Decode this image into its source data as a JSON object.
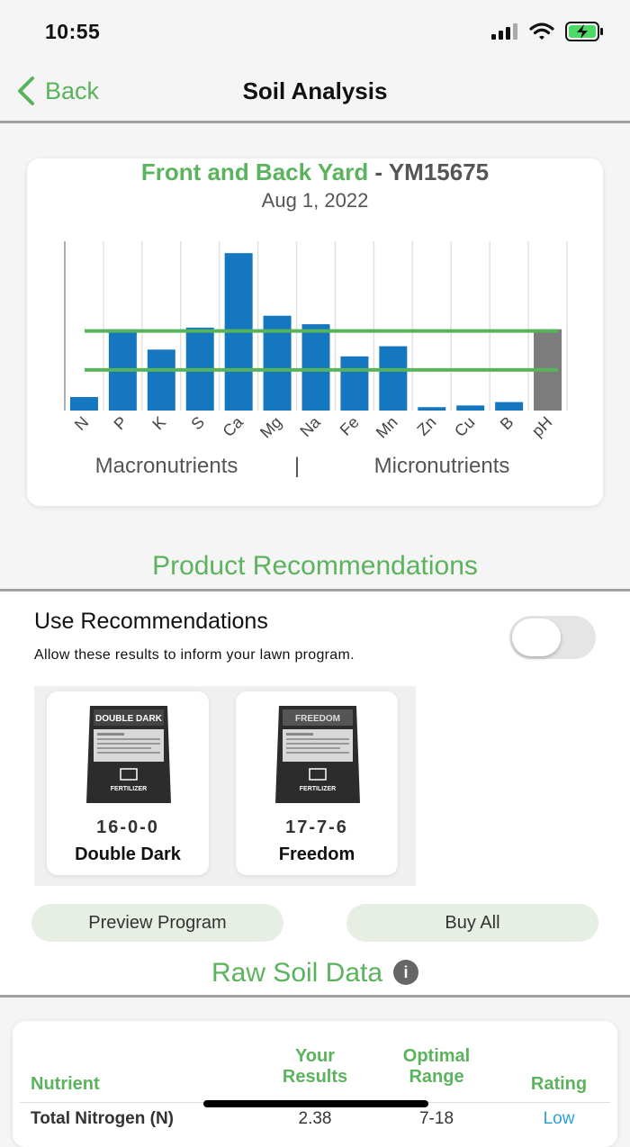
{
  "status_bar": {
    "time": "10:55"
  },
  "nav": {
    "back_label": "Back",
    "title": "Soil Analysis"
  },
  "chart_header": {
    "location": "Front and Back Yard",
    "separator": " - ",
    "sample_id": "YM15675",
    "date": "Aug 1, 2022"
  },
  "chart_data": {
    "type": "bar",
    "categories": [
      "N",
      "P",
      "K",
      "S",
      "Ca",
      "Mg",
      "Na",
      "Fe",
      "Mn",
      "Zn",
      "Cu",
      "B",
      "pH"
    ],
    "values": [
      8,
      48,
      36,
      49,
      93,
      56,
      51,
      32,
      38,
      2,
      3,
      5,
      48
    ],
    "ylim": [
      0,
      100
    ],
    "optimal_band": [
      24,
      47
    ],
    "colors": {
      "bar": "#1577c0",
      "ph_bar": "#7c7c7c",
      "band": "#58b45a",
      "grid": "#e2e2e2"
    },
    "group_labels": {
      "left": "Macronutrients",
      "divider": "|",
      "right": "Micronutrients"
    }
  },
  "recommendations": {
    "title": "Product Recommendations",
    "use_label": "Use Recommendations",
    "use_subtext": "Allow these results to inform your lawn program.",
    "toggle_on": false,
    "products": [
      {
        "npk": "16-0-0",
        "name": "Double Dark",
        "bag_text": "DOUBLE DARK",
        "bag_sub": "FERTILIZER"
      },
      {
        "npk": "17-7-6",
        "name": "Freedom",
        "bag_text": "FREEDOM",
        "bag_sub": "FERTILIZER"
      }
    ],
    "preview_button": "Preview Program",
    "buy_button": "Buy All"
  },
  "raw": {
    "title": "Raw Soil Data",
    "headers": {
      "nutrient": "Nutrient",
      "results": "Your Results",
      "optimal": "Optimal Range",
      "rating": "Rating"
    },
    "rows": [
      {
        "nutrient": "Total Nitrogen (N)",
        "result": "2.38",
        "range": "7-18",
        "rating": "Low"
      }
    ]
  }
}
